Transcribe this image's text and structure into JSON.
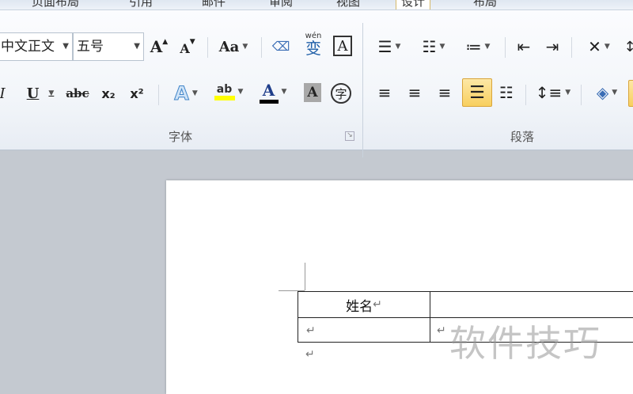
{
  "tabs": [
    "页面布局",
    "引用",
    "邮件",
    "审阅",
    "视图",
    "设计",
    "布局"
  ],
  "font_group": {
    "label": "字体",
    "font_name": "中文正文",
    "font_size": "五号",
    "grow_font": "A",
    "shrink_font": "A",
    "change_case": "Aa",
    "phonetic_guide": "wén",
    "phonetic_char": "变",
    "char_border": "A",
    "underline": "U",
    "strikethrough": "abc",
    "subscript": "x₂",
    "superscript": "x²",
    "text_effects": "A",
    "highlight": "ab",
    "font_color": "A",
    "char_shading": "A",
    "enclose_char": "字"
  },
  "paragraph_group": {
    "label": "段落"
  },
  "document": {
    "table_header_cell": "姓名",
    "paragraph_mark": "↵"
  },
  "watermark": "软件技巧",
  "colors": {
    "accent_highlight": "#f8cf5e",
    "font_color_bar": "#000000",
    "highlight_bar": "#ffff00"
  }
}
